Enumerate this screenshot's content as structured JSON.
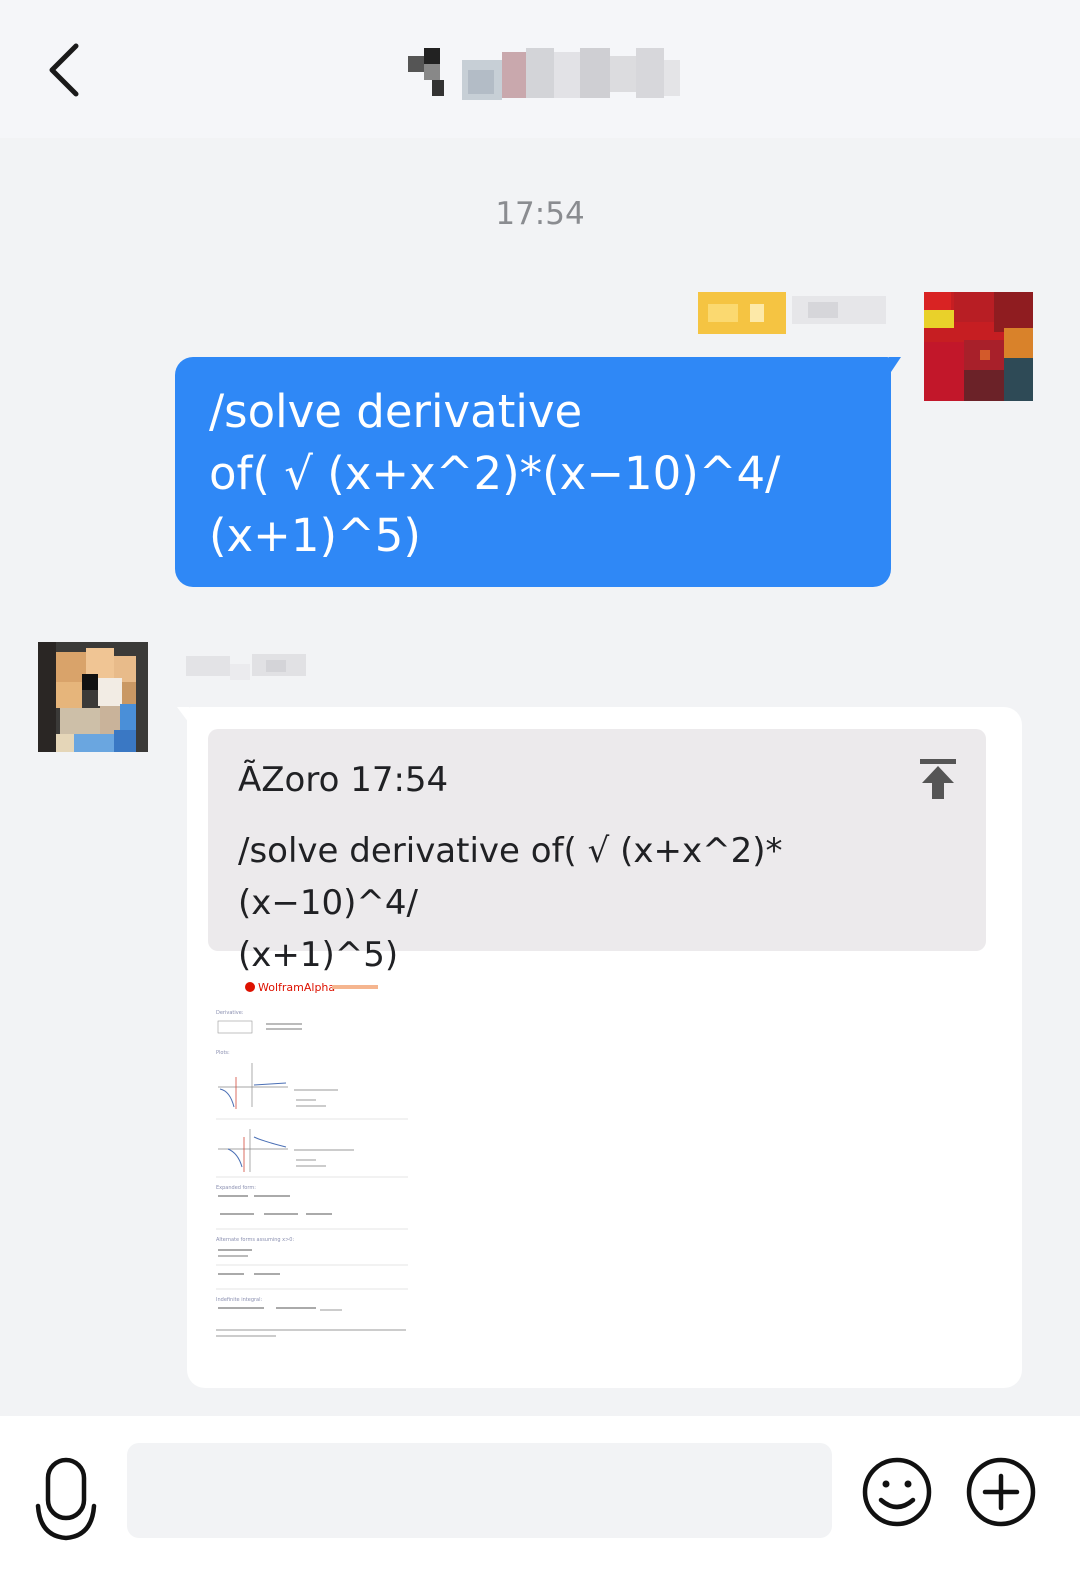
{
  "header": {
    "back_icon": "chevron-left-icon"
  },
  "chat": {
    "timestamp": "17:54",
    "outgoing": {
      "text_line1": "/solve derivative",
      "text_line2": "of( √ (x+x^2)*(x−10)^4/",
      "text_line3": "(x+1)^5)"
    },
    "incoming": {
      "quote": {
        "header": "ÃZoro 17:54",
        "text_line1": "/solve derivative of( √ (x+x^2)*(x−10)^4/",
        "text_line2": "(x+1)^5)",
        "icon": "scroll-to-top-icon"
      },
      "result_image": {
        "logo_text": "WolframAlpha",
        "sections": [
          "Derivative:",
          "Plots:",
          "Expanded form:",
          "Alternate forms assuming x>0:",
          "Indefinite integral:"
        ]
      }
    }
  },
  "composer": {
    "mic_icon": "microphone-icon",
    "input_value": "",
    "emoji_icon": "smiley-icon",
    "plus_icon": "plus-circle-icon"
  },
  "colors": {
    "accent": "#2f88f6",
    "background": "#f2f3f5",
    "wolfram_red": "#dd1100"
  }
}
